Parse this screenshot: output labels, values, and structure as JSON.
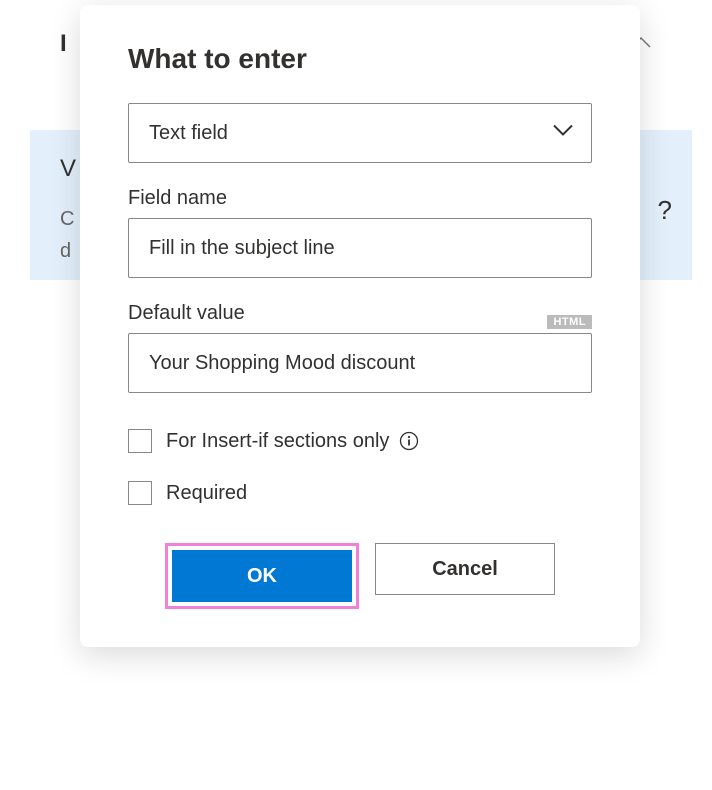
{
  "backdrop": {
    "partial1": "I",
    "partial2": "V",
    "partial3": "C",
    "partial4": "d",
    "partial5": "?"
  },
  "dialog": {
    "title": "What to enter",
    "field_type": {
      "selected": "Text field"
    },
    "field_name": {
      "label": "Field name",
      "value": "Fill in the subject line"
    },
    "default_value": {
      "label": "Default value",
      "badge": "HTML",
      "value": "Your Shopping Mood discount"
    },
    "checkbox_insert_if": {
      "label": "For Insert-if sections only",
      "checked": false
    },
    "checkbox_required": {
      "label": "Required",
      "checked": false
    },
    "buttons": {
      "ok": "OK",
      "cancel": "Cancel"
    }
  }
}
